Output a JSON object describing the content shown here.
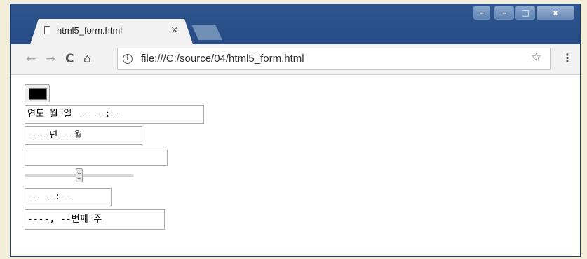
{
  "browser": {
    "tab_title": "html5_form.html",
    "tab_close": "×",
    "url": "file:///C:/source/04/html5_form.html",
    "nav": {
      "back": "←",
      "forward": "→",
      "reload": "C",
      "home": "⌂",
      "info": "i",
      "star": "☆",
      "menu": "⋮"
    },
    "window_controls": {
      "minimize": "–",
      "maximize": "□",
      "close": "x"
    }
  },
  "form": {
    "color_value": "#000000",
    "datetime_local": "연도-월-일 -- --:--",
    "month": "----년 --월",
    "text": "",
    "range_value_fraction": 0.5,
    "time": "-- --:--",
    "week": "----, --번째 주"
  }
}
